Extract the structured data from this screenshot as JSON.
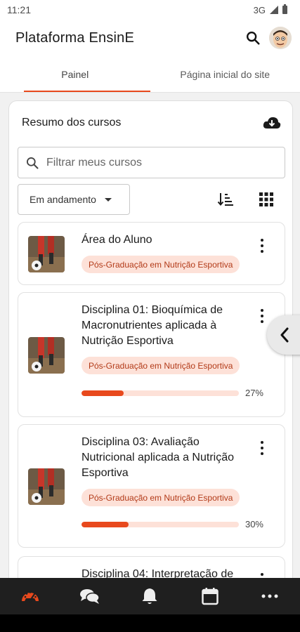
{
  "status_bar": {
    "time": "11:21",
    "network": "3G"
  },
  "header": {
    "title": "Plataforma EnsinE"
  },
  "tabs": [
    {
      "label": "Painel",
      "active": true
    },
    {
      "label": "Página inicial do site",
      "active": false
    }
  ],
  "block": {
    "title": "Resumo dos cursos",
    "filter_placeholder": "Filtrar meus cursos",
    "status_filter": "Em andamento"
  },
  "courses": [
    {
      "name": "Área do Aluno",
      "category": "Pós-Graduação em Nutrição Esportiva",
      "progress": null
    },
    {
      "name": "Disciplina 01: Bioquímica de Macronutrientes aplicada à Nutrição Esportiva",
      "category": "Pós-Graduação em Nutrição Esportiva",
      "progress": 27,
      "progress_label": "27%"
    },
    {
      "name": "Disciplina 03: Avaliação Nutricional aplicada a Nutrição Esportiva",
      "category": "Pós-Graduação em Nutrição Esportiva",
      "progress": 30,
      "progress_label": "30%"
    },
    {
      "name": "Disciplina 04: Interpretação de",
      "category": "",
      "progress": null
    }
  ],
  "bottom_nav": [
    "dashboard-icon",
    "messages-icon",
    "notifications-icon",
    "calendar-icon",
    "more-icon"
  ],
  "colors": {
    "accent": "#e8491d",
    "badge_bg": "#fde1d8",
    "badge_text": "#b23a18",
    "nav_bg": "#1f1f1f"
  }
}
